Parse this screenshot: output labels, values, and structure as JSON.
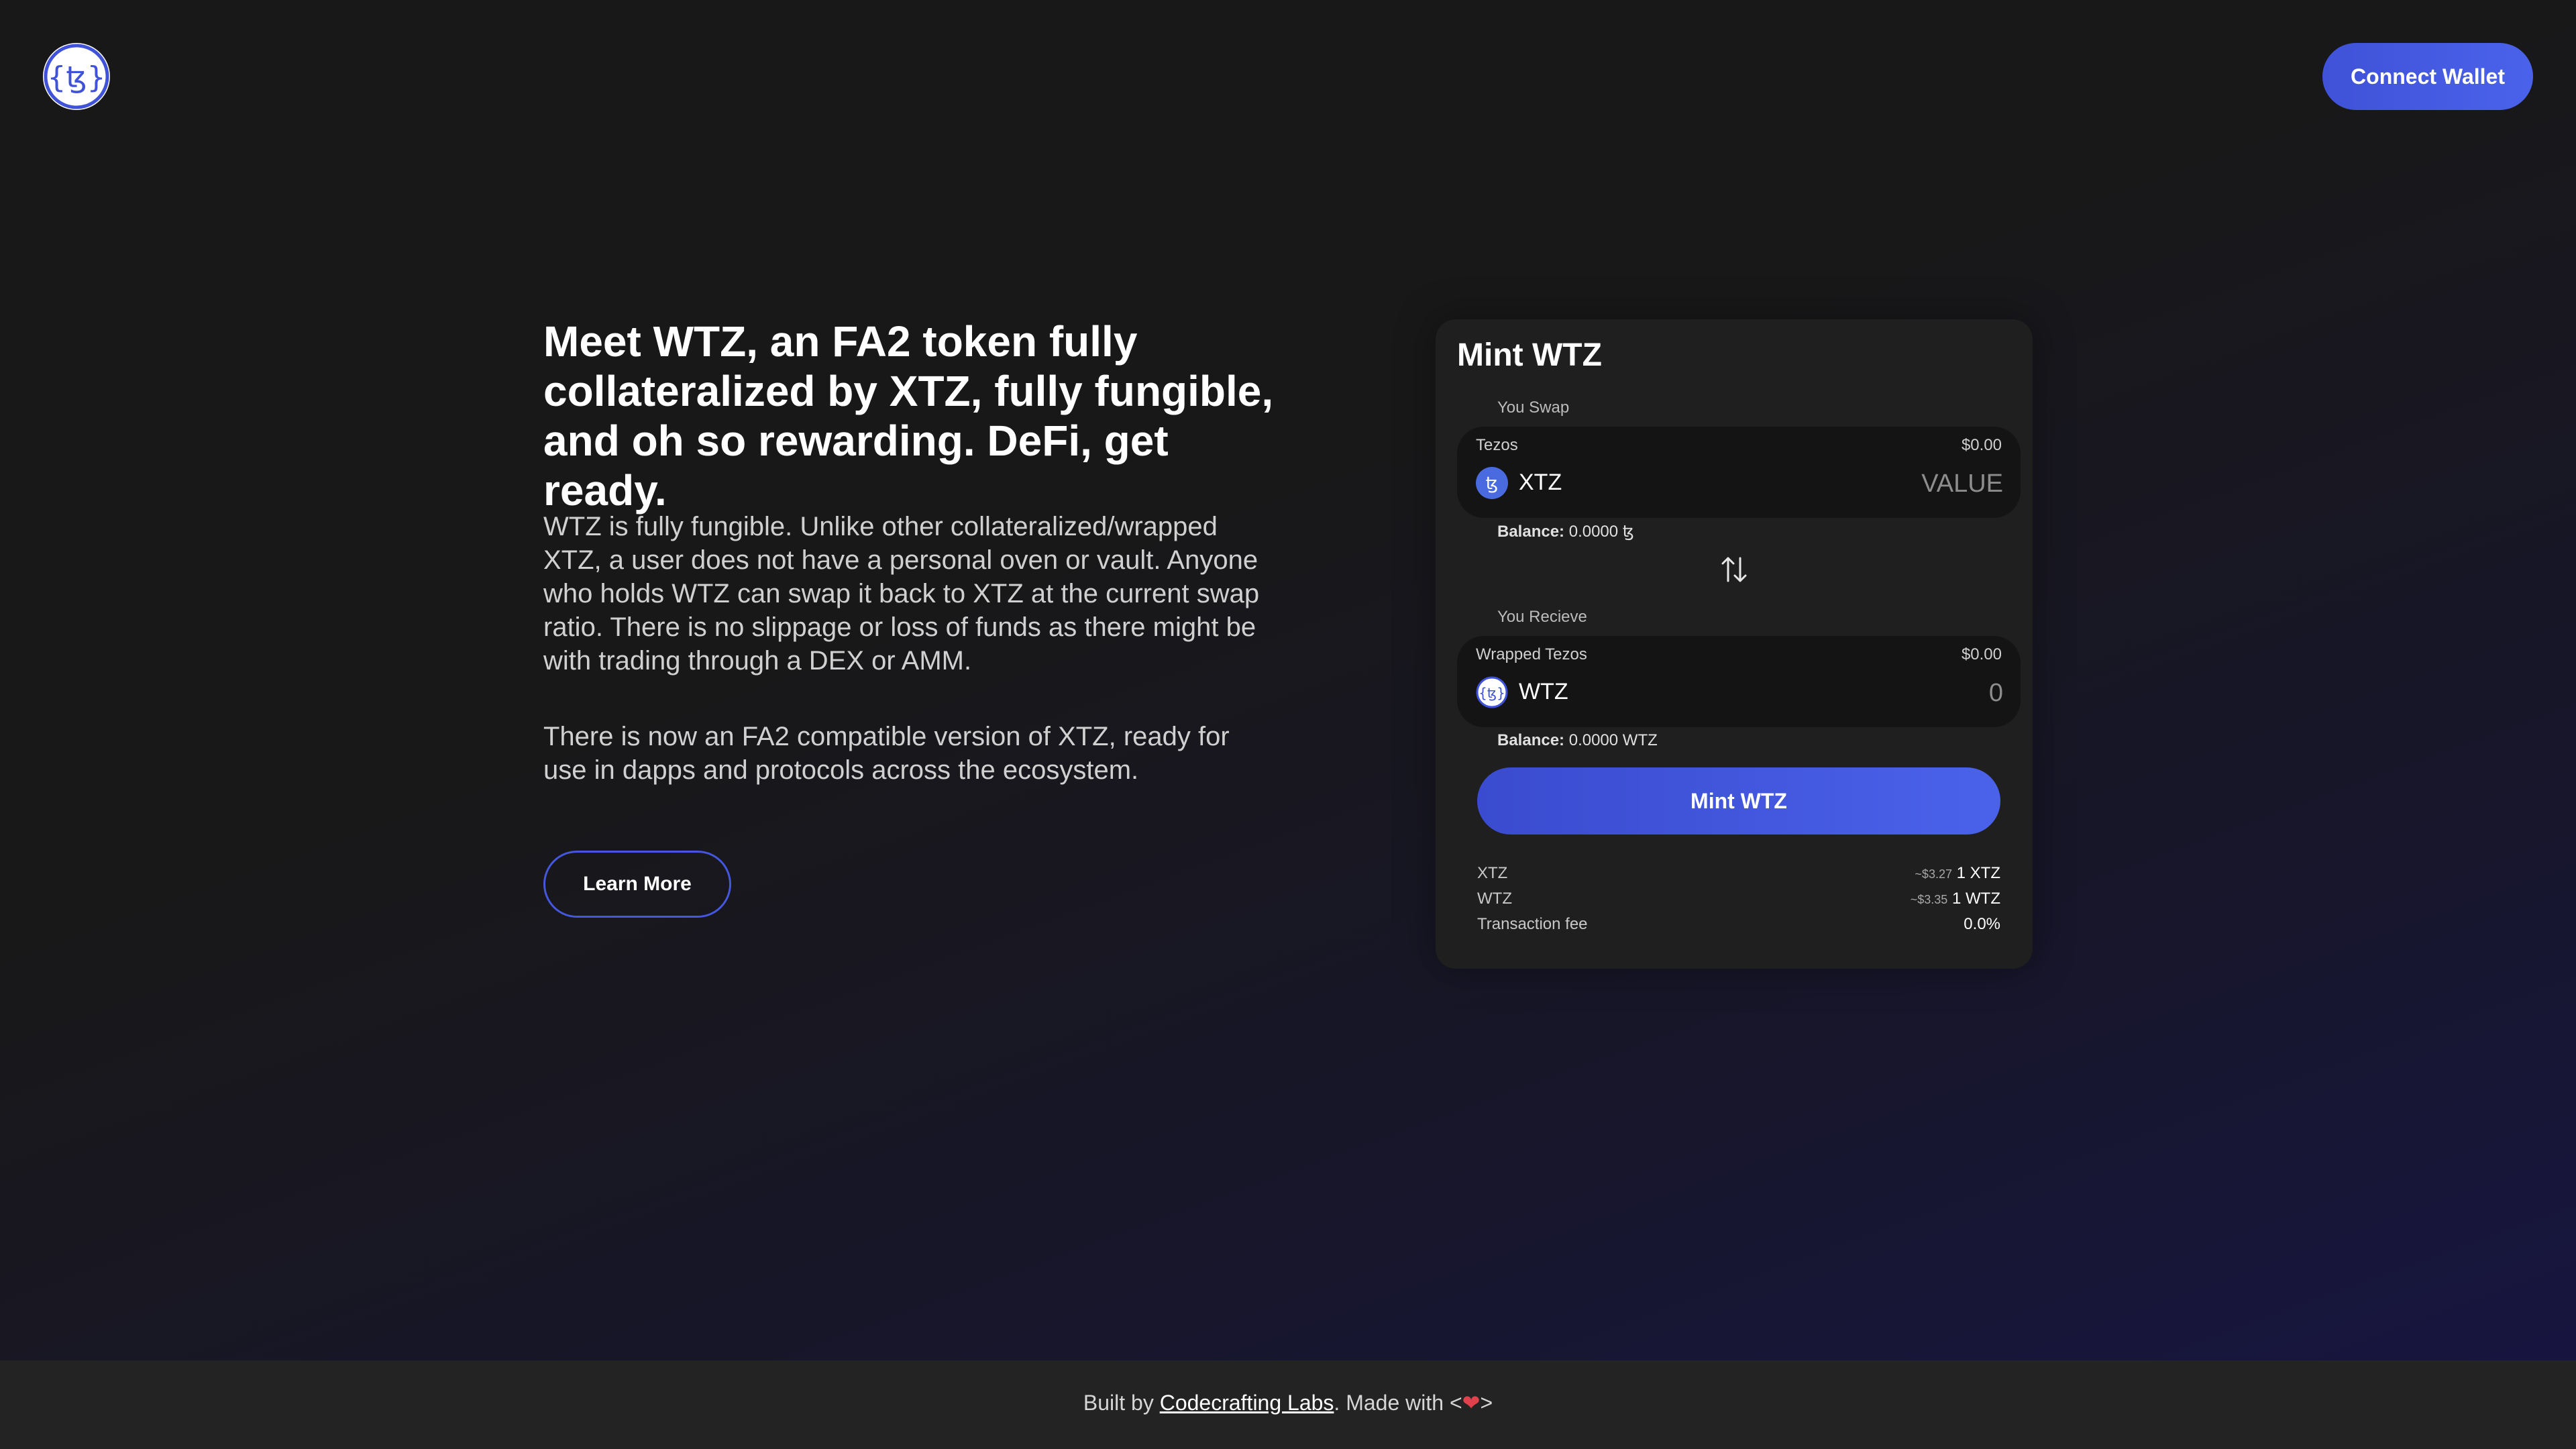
{
  "header": {
    "logo_icon": "tz-logo-icon",
    "connect_label": "Connect Wallet"
  },
  "hero": {
    "headline": "Meet WTZ, an FA2 token fully collateralized by XTZ, fully fungible, and oh so rewarding. DeFi, get ready.",
    "paragraph1": "WTZ is fully fungible. Unlike other collateralized/wrapped XTZ, a user does not have a personal oven or vault. Anyone who holds WTZ can swap it back to XTZ at the current swap ratio. There is no slippage or loss of funds as there might be with trading through a DEX or AMM.",
    "paragraph2": "There is now an FA2 compatible version of XTZ, ready for use in dapps and protocols across the ecosystem.",
    "learn_more_label": "Learn More"
  },
  "mint_card": {
    "title": "Mint WTZ",
    "you_swap_label": "You Swap",
    "from": {
      "name": "Tezos",
      "usd": "$0.00",
      "symbol": "XTZ",
      "placeholder": "VALUE",
      "balance_label": "Balance:",
      "balance_value": "0.0000 ꜩ",
      "icon": "tezos-icon"
    },
    "swap_icon": "swap-arrows-icon",
    "you_receive_label": "You Recieve",
    "to": {
      "name": "Wrapped Tezos",
      "usd": "$0.00",
      "symbol": "WTZ",
      "placeholder": "0",
      "balance_label": "Balance:",
      "balance_value": "0.0000 WTZ",
      "icon": "wtz-icon"
    },
    "mint_label": "Mint WTZ",
    "rates": [
      {
        "label": "XTZ",
        "approx": "~$3.27",
        "value": "1 XTZ"
      },
      {
        "label": "WTZ",
        "approx": "~$3.35",
        "value": "1 WTZ"
      },
      {
        "label": "Transaction fee",
        "approx": "",
        "value": "0.0%"
      }
    ]
  },
  "footer": {
    "prefix": "Built by ",
    "link": "Codecrafting Labs",
    "suffix": ". Made with ",
    "lt": "<",
    "gt": ">",
    "heart_icon": "heart-icon"
  },
  "colors": {
    "accent": "#4457dd",
    "background": "#181818",
    "card": "#1f1f1f",
    "input": "#141414",
    "heart": "#e0414c"
  }
}
